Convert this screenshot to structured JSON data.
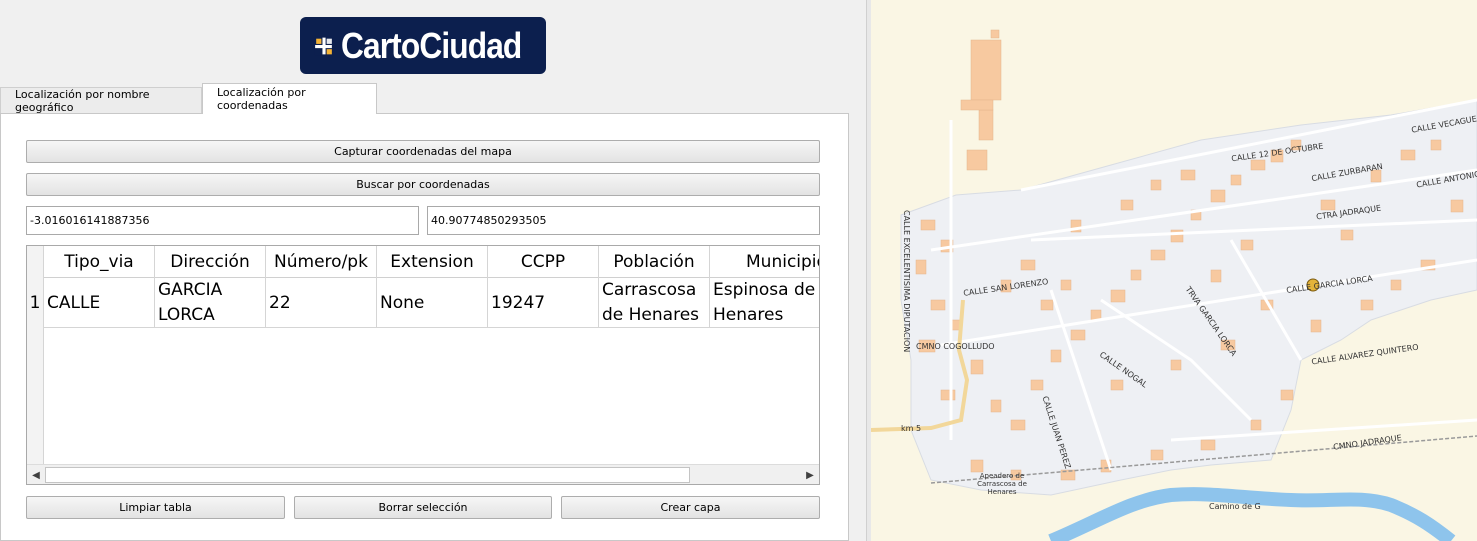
{
  "logo": {
    "text": "CartoCiudad"
  },
  "tabs": [
    {
      "label": "Localización por nombre geográfico",
      "active": false
    },
    {
      "label": "Localización por coordenadas",
      "active": true
    }
  ],
  "buttons": {
    "capture": "Capturar coordenadas del mapa",
    "search": "Buscar por coordenadas",
    "clear_table": "Limpiar tabla",
    "delete_selection": "Borrar selección",
    "create_layer": "Crear capa"
  },
  "coords": {
    "lon": "-3.016016141887356",
    "lat": "40.90774850293505"
  },
  "table": {
    "columns": [
      "Tipo_via",
      "Dirección",
      "Número/pk",
      "Extension",
      "CCPP",
      "Población",
      "Municipio"
    ],
    "rows": [
      {
        "num": "1",
        "cells": [
          "CALLE",
          "GARCIA LORCA",
          "22",
          "None",
          "19247",
          "Carrascosa de Henares",
          "Espinosa de Henares"
        ]
      }
    ]
  },
  "map": {
    "street_labels": [
      "CALLE 12 DE OCTUBRE",
      "CALLE VECAGUE",
      "CALLE ZURBARAN",
      "CALLE ANTONIO",
      "CALLE EXCELENTISIMA DIPUTACION",
      "CTRA JADRAQUE",
      "CALLE SAN LORENZO",
      "CALLE GARCIA LORCA",
      "TRVA GARCIA LORCA",
      "CMNO COGOLLUDO",
      "CALLE NOGAL",
      "CALLE ALVAREZ QUINTERO",
      "CALLE JUAN PEREZ",
      "CMNO JADRAQUE",
      "Apeadero de Carrascosa de Henares",
      "Camino de G",
      "km 5"
    ],
    "colors": {
      "background": "#faf6e4",
      "urban": "#eef0f4",
      "building": "#f7c9a0",
      "river": "#8ec4ec",
      "marker": "#e3b33a"
    }
  }
}
